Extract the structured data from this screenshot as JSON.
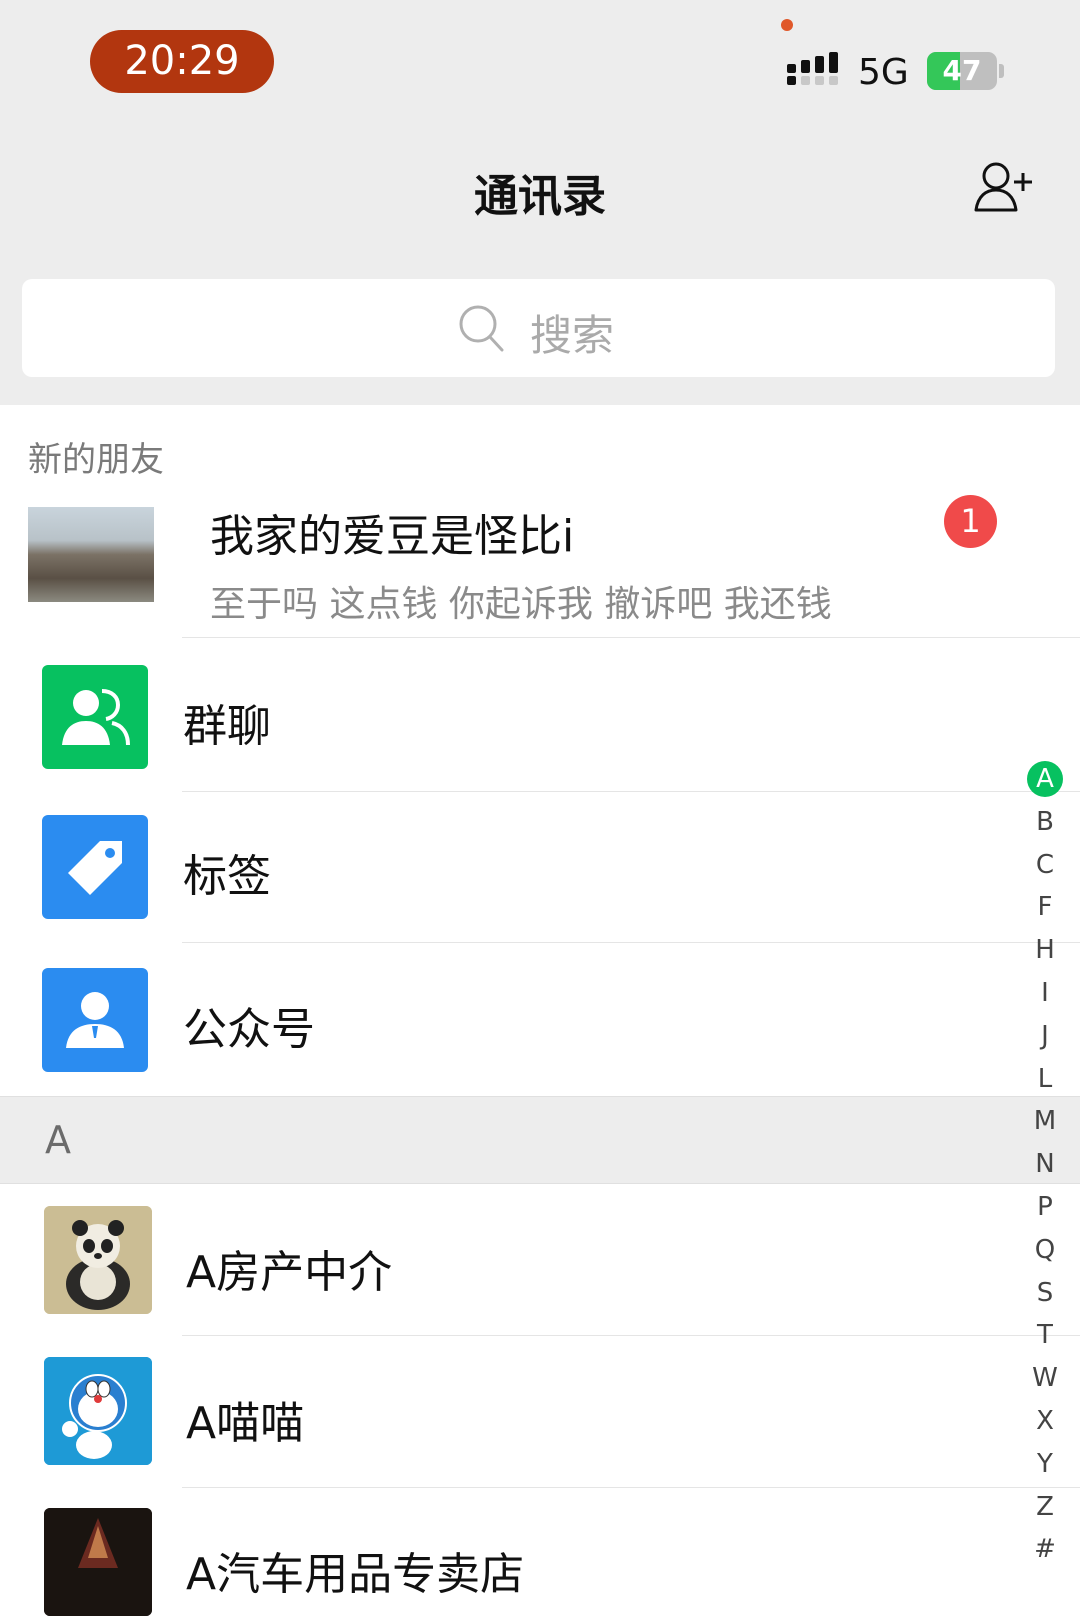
{
  "status_bar": {
    "time": "20:29",
    "network": "5G",
    "battery_percent": 47,
    "battery_label": "47"
  },
  "nav": {
    "title": "通讯录",
    "add_icon": "add-friend-icon"
  },
  "search": {
    "placeholder": "搜索",
    "icon": "search-icon"
  },
  "new_friends": {
    "header": "新的朋友",
    "request": {
      "name": "我家的爱豆是怪比i",
      "message": "至于吗 这点钱 你起诉我 撤诉吧 我还钱",
      "badge": "1"
    }
  },
  "functions": [
    {
      "label": "群聊",
      "icon": "group-chat-icon",
      "color": "#07c160"
    },
    {
      "label": "标签",
      "icon": "tag-icon",
      "color": "#2b8cf0"
    },
    {
      "label": "公众号",
      "icon": "official-account-icon",
      "color": "#2b8cf0"
    }
  ],
  "sections": [
    {
      "letter": "A",
      "contacts": [
        {
          "name": "A房产中介",
          "avatar": "panda-avatar"
        },
        {
          "name": "A喵喵",
          "avatar": "doraemon-avatar"
        },
        {
          "name": "A汽车用品专卖店",
          "avatar": "dark-avatar"
        }
      ]
    }
  ],
  "index_bar": {
    "active": "A",
    "letters": [
      "A",
      "B",
      "C",
      "F",
      "H",
      "I",
      "J",
      "L",
      "M",
      "N",
      "P",
      "Q",
      "S",
      "T",
      "W",
      "X",
      "Y",
      "Z",
      "#"
    ]
  },
  "colors": {
    "accent_green": "#07c160",
    "badge_red": "#f04a4a",
    "time_pill": "#b2360f",
    "icon_blue": "#2b8cf0"
  }
}
